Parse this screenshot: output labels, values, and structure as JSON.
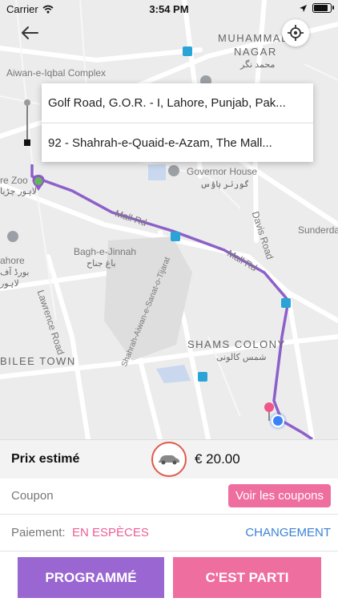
{
  "status_bar": {
    "carrier": "Carrier",
    "time": "3:54 PM"
  },
  "map": {
    "labels": {
      "muhammad_nagar": "MUHAMMAD",
      "nagar": "NAGAR",
      "muhammad_nagar_urdu": "محمد نگر",
      "aiwan_complex": "Aiwan-e-Iqbal Complex",
      "zoo": "re Zoo",
      "zoo_urdu": "لاہور چڑیا",
      "governor_house": "Governor House",
      "governor_house_urdu": "گورنر ہاؤس",
      "davis_road": "Davis Road",
      "sunderdas": "Sunderdas",
      "mall_rd_1": "Mall Rd",
      "mall_rd_2": "Mall Rd",
      "bagh_e_jinnah": "Bagh-e-Jinnah",
      "bagh_e_jinnah_urdu": "باغ جناح",
      "lahore": "ahore",
      "lahore_urdu": "بورڈ آف",
      "lahore_urdu_2": "لاہور",
      "lawrence_road": "Lawrence Road",
      "shahrah": "Shahrah-Aiwan-e-Sanat-o-Tijarat",
      "jubilee_town": "BILEE TOWN",
      "shams_colony": "SHAMS COLONY",
      "shams_colony_urdu": "شمس کالونی"
    }
  },
  "addresses": {
    "pickup": "Golf Road, G.O.R. - I, Lahore, Punjab, Pak...",
    "dropoff": "92 - Shahrah-e-Quaid-e-Azam, The Mall..."
  },
  "price": {
    "label": "Prix estimé",
    "value": "€ 20.00"
  },
  "coupon": {
    "label": "Coupon",
    "button": "Voir les coupons"
  },
  "payment": {
    "label": "Paiement:",
    "method": "EN ESPÈCES",
    "change": "CHANGEMENT"
  },
  "actions": {
    "schedule": "PROGRAMMÉ",
    "go": "C'EST PARTI"
  },
  "colors": {
    "accent_pink": "#ef6ea0",
    "accent_purple": "#9a66d2",
    "link_blue": "#3b82d6",
    "car_ring": "#e05a48"
  }
}
